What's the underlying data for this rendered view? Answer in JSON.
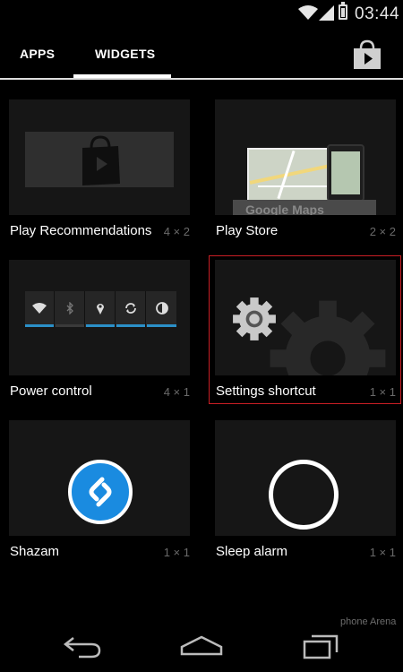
{
  "status_bar": {
    "time": "03:44",
    "icons": [
      "wifi-icon",
      "signal-icon",
      "battery-icon"
    ]
  },
  "tabs": [
    {
      "label": "APPS",
      "selected": false
    },
    {
      "label": "WIDGETS",
      "selected": true
    }
  ],
  "store_icon": "play-store-icon",
  "widgets": [
    {
      "label": "Play Recommendations",
      "size": "4 × 2"
    },
    {
      "label": "Play Store",
      "size": "2 × 2",
      "preview_text": "Google Maps"
    },
    {
      "label": "Power control",
      "size": "4 × 1"
    },
    {
      "label": "Settings shortcut",
      "size": "1 × 1",
      "highlighted": true
    },
    {
      "label": "Shazam",
      "size": "1 × 1"
    },
    {
      "label": "Sleep alarm",
      "size": "1 × 1"
    }
  ],
  "power_control_icons": [
    "wifi-icon",
    "bluetooth-icon",
    "location-icon",
    "sync-icon",
    "brightness-icon"
  ],
  "nav_bar": {
    "icons": [
      "back-icon",
      "home-icon",
      "recent-apps-icon"
    ]
  },
  "watermark": "phone Arena",
  "colors": {
    "accent": "#2b90c8",
    "highlight": "#c81e24",
    "background": "#000000",
    "card": "#161616"
  }
}
